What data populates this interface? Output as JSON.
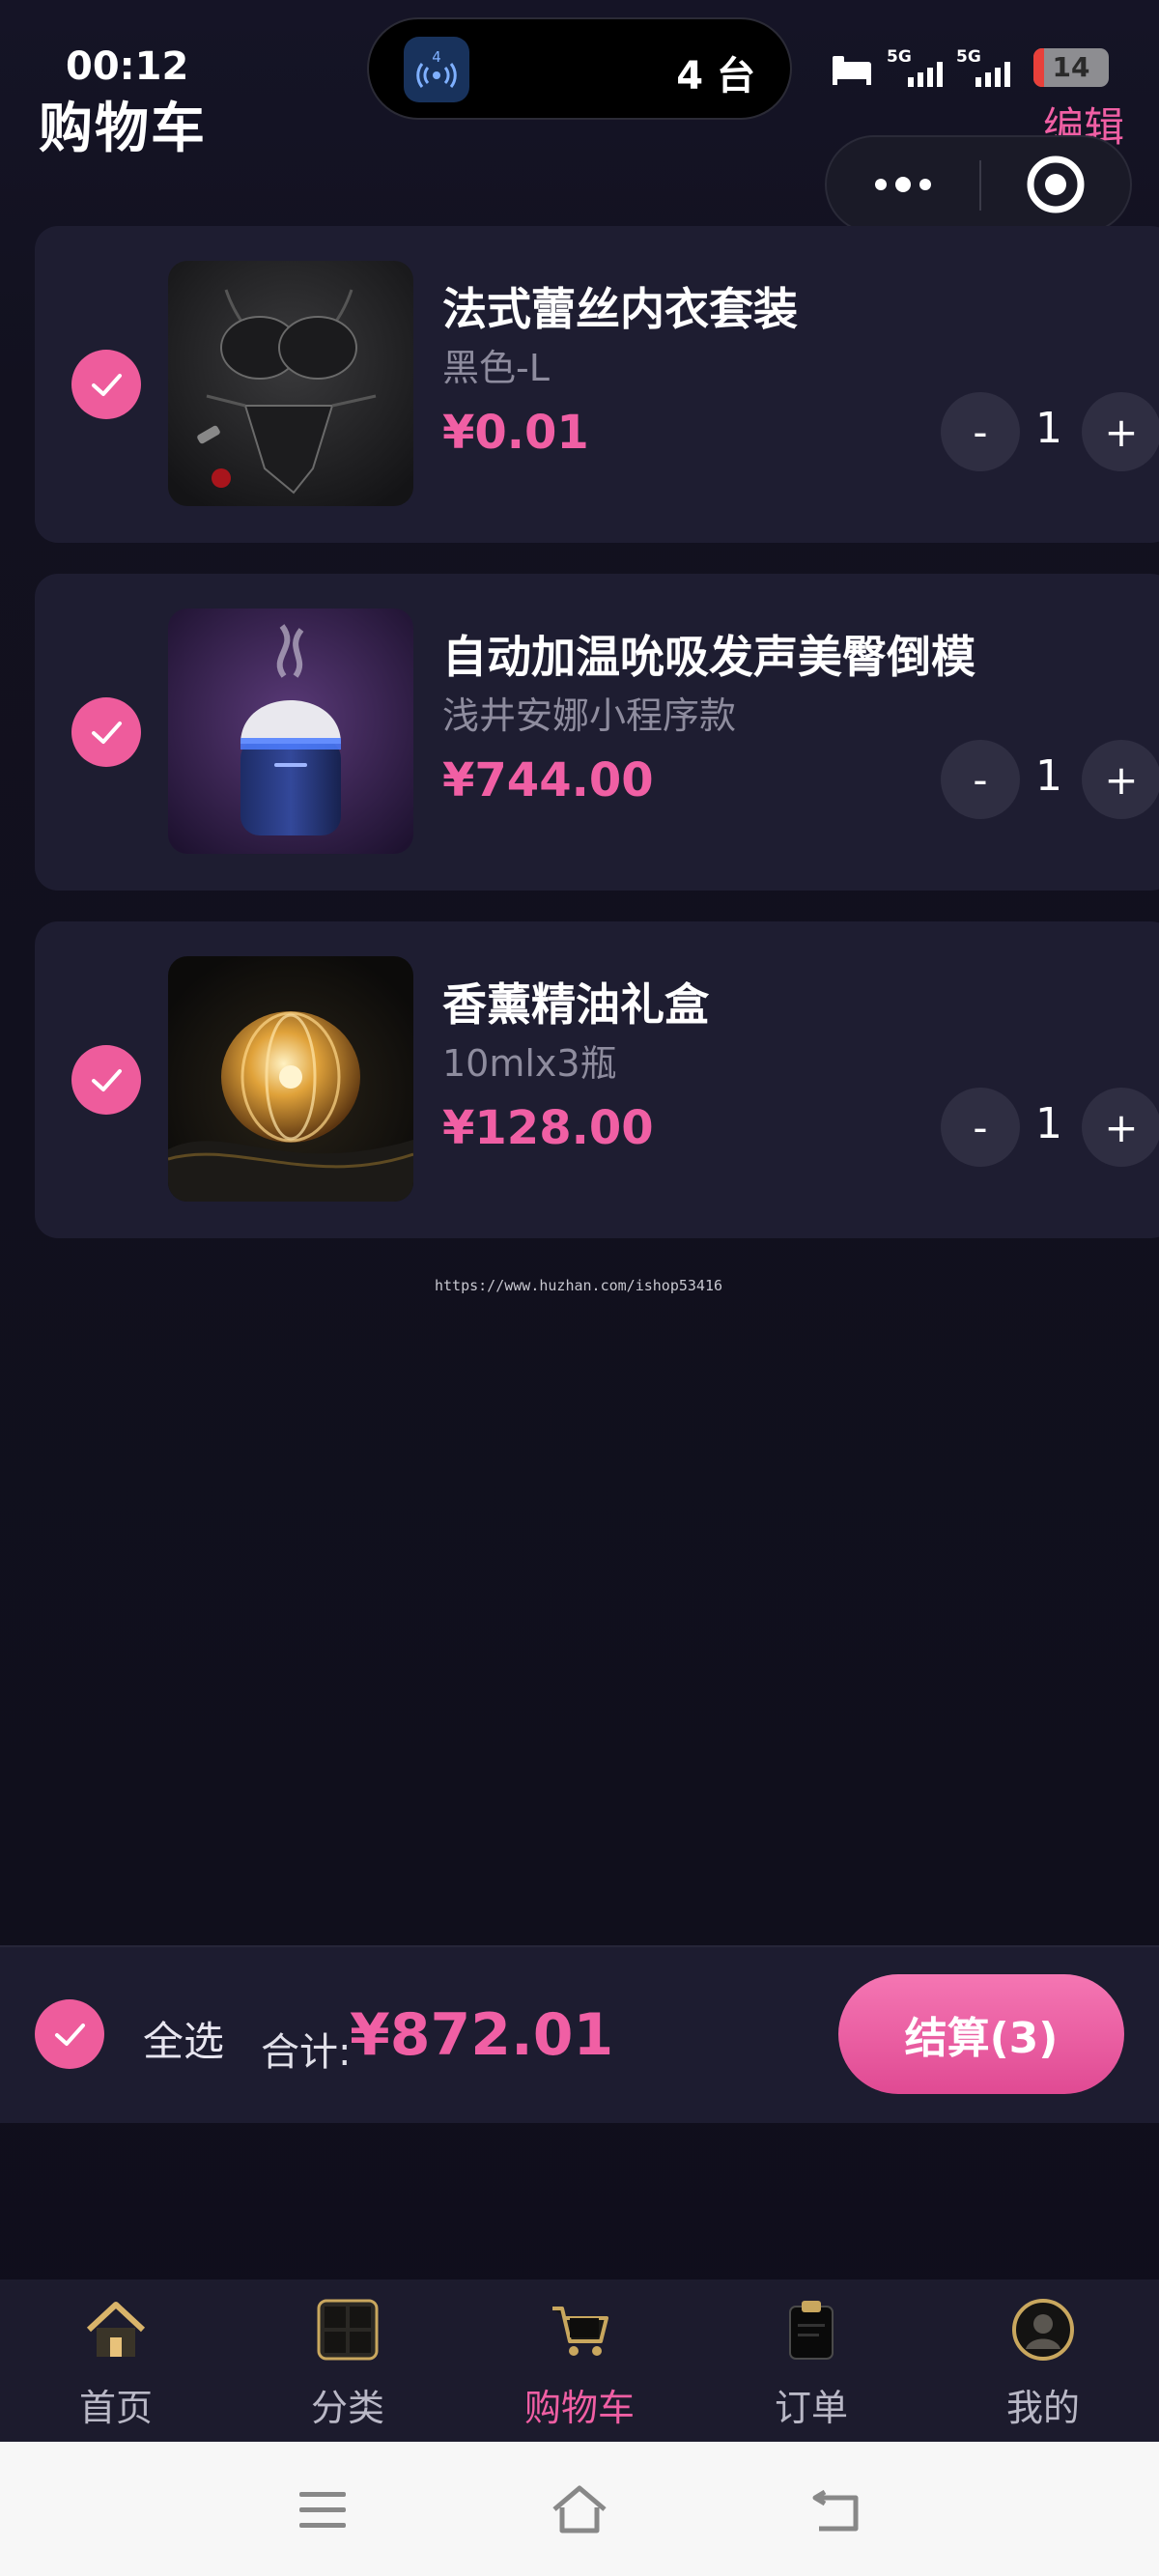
{
  "status_bar": {
    "time": "00:12",
    "island_text": "4 台",
    "island_app_badge": "4",
    "network_1": "5G",
    "network_2": "5G",
    "battery": "14",
    "battery_level": 0.14
  },
  "header": {
    "title": "购物车",
    "edit": "编辑"
  },
  "items": [
    {
      "name": "法式蕾丝内衣套装",
      "spec": "黑色-L",
      "price": "¥0.01",
      "quantity": "1",
      "minus": "-",
      "plus": "+",
      "checked": true,
      "image": "lace-lingerie-image"
    },
    {
      "name": "自动加温吮吸发声美臀倒模",
      "spec": "浅井安娜小程序款",
      "price": "¥744.00",
      "quantity": "1",
      "minus": "-",
      "plus": "+",
      "checked": true,
      "image": "product-humidifier-image"
    },
    {
      "name": "香薰精油礼盒",
      "spec": "10mlx3瓶",
      "price": "¥128.00",
      "quantity": "1",
      "minus": "-",
      "plus": "+",
      "checked": true,
      "image": "perfume-bottle-image"
    }
  ],
  "watermark": "https://www.huzhan.com/ishop53416",
  "checkout": {
    "select_all": "全选",
    "total_label": "合计:",
    "total_value": "¥872.01",
    "button": "结算(3)"
  },
  "tabs": [
    {
      "label": "首页",
      "icon": "home-icon",
      "active": false
    },
    {
      "label": "分类",
      "icon": "category-icon",
      "active": false
    },
    {
      "label": "购物车",
      "icon": "cart-icon",
      "active": true
    },
    {
      "label": "订单",
      "icon": "order-icon",
      "active": false
    },
    {
      "label": "我的",
      "icon": "profile-icon",
      "active": false
    }
  ],
  "colors": {
    "accent": "#f05fa4",
    "background": "#11101f",
    "card": "#1e1d31"
  }
}
